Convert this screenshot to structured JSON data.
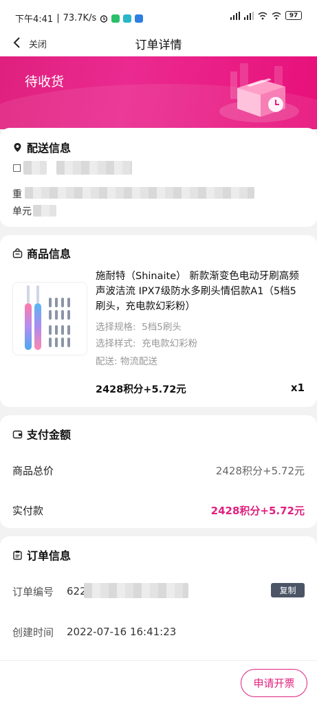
{
  "status_bar": {
    "time": "下午4:41",
    "network_speed": "73.7K/s",
    "battery": "97",
    "icons": [
      "alarm-icon",
      "app-icon",
      "app-icon",
      "app-icon",
      "signal-icon",
      "signal-icon",
      "wifi-icon",
      "wifi-icon",
      "battery-icon"
    ]
  },
  "nav": {
    "close_label": "关闭",
    "title": "订单详情"
  },
  "banner": {
    "status": "待收货"
  },
  "delivery": {
    "title": "配送信息",
    "name_initial": "□",
    "address_prefix": "重",
    "unit_prefix": "单元"
  },
  "product": {
    "title": "商品信息",
    "name": "施耐特（Shinaite） 新款渐变色电动牙刷高频声波洁流 IPX7级防水多刷头情侣款A1（5档5刷头，充电款幻彩粉）",
    "spec_label": "选择规格:",
    "spec_value": "5档5刷头",
    "style_label": "选择样式:",
    "style_value": "充电款幻彩粉",
    "delivery_method": "配送: 物流配送",
    "price": "2428积分+5.72元",
    "quantity": "x1"
  },
  "payment": {
    "title": "支付金额",
    "total_label": "商品总价",
    "total_value": "2428积分+5.72元",
    "paid_label": "实付款",
    "paid_value": "2428积分+5.72元"
  },
  "order": {
    "title": "订单信息",
    "number_label": "订单编号",
    "number_prefix": "622",
    "copy_label": "复制",
    "created_label": "创建时间",
    "created_value": "2022-07-16 16:41:23"
  },
  "footer": {
    "invoice_label": "申请开票"
  },
  "colors": {
    "accent": "#e0207e",
    "copy_button": "#4b5566"
  }
}
